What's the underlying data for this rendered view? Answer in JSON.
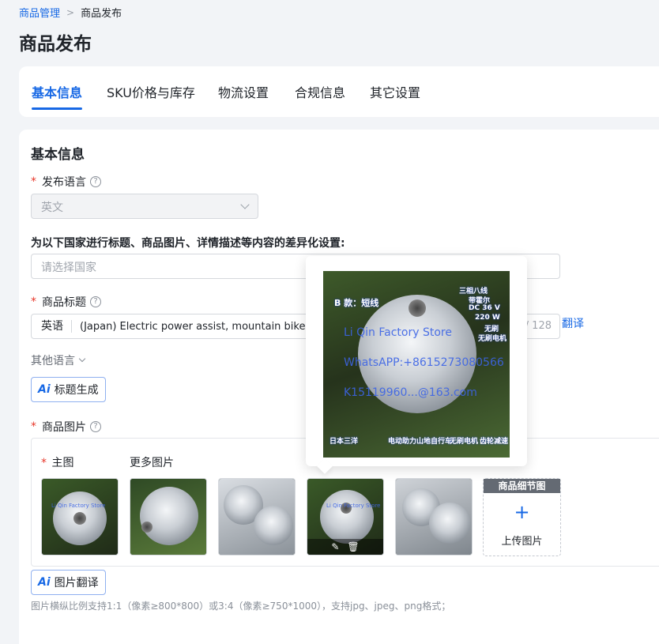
{
  "breadcrumb": {
    "parent": "商品管理",
    "current": "商品发布"
  },
  "page_title": "商品发布",
  "tabs": [
    {
      "label": "基本信息",
      "active": true
    },
    {
      "label": "SKU价格与库存",
      "active": false
    },
    {
      "label": "物流设置",
      "active": false
    },
    {
      "label": "合规信息",
      "active": false
    },
    {
      "label": "其它设置",
      "active": false
    }
  ],
  "section_title": "基本信息",
  "publish_language": {
    "label": "发布语言",
    "value": "英文"
  },
  "country_setting": {
    "label": "为以下国家进行标题、商品图片、详情描述等内容的差异化设置:",
    "placeholder": "请选择国家"
  },
  "product_title": {
    "label": "商品标题",
    "language": "英语",
    "value": "(Japan) Electric power assist, mountain bike, brushless motor",
    "counter": "/ 128",
    "translate": "翻译"
  },
  "other_languages": "其他语言",
  "ai_title_button": {
    "mark": "Ai",
    "label": "标题生成"
  },
  "product_images": {
    "label": "商品图片",
    "main_label": "主图",
    "more_label": "更多图片",
    "detail_header": "商品细节图",
    "upload_label": "上传图片",
    "thumbnails": [
      {
        "caption": "Li Qin Factory Store"
      },
      {
        "caption": ""
      },
      {
        "caption": ""
      },
      {
        "caption": "Li Qin Factory Store"
      },
      {
        "caption": ""
      }
    ]
  },
  "ai_image_button": {
    "mark": "Ai",
    "label": "图片翻译"
  },
  "image_hint": "图片横纵比例支持1:1（像素≥800*800）或3:4（像素≥750*1000），支持jpg、jpeg、png格式；",
  "preview": {
    "top_left": "B 款：短线",
    "top_right_lines": [
      "三相八线",
      "带霍尔",
      "DC 36 V",
      "220 W",
      "无刷",
      "无刷电机"
    ],
    "watermark_1": "Li Qin Factory Store",
    "watermark_2": "WhatsAPP:+8615273080566",
    "watermark_3": "K15119960...@163.com",
    "bottom_labels": [
      "日本三洋",
      "电动助力",
      "山地自行车",
      "无刷电机",
      "齿轮减速"
    ]
  },
  "colors": {
    "accent": "#1768e5",
    "required": "#e8382b"
  }
}
